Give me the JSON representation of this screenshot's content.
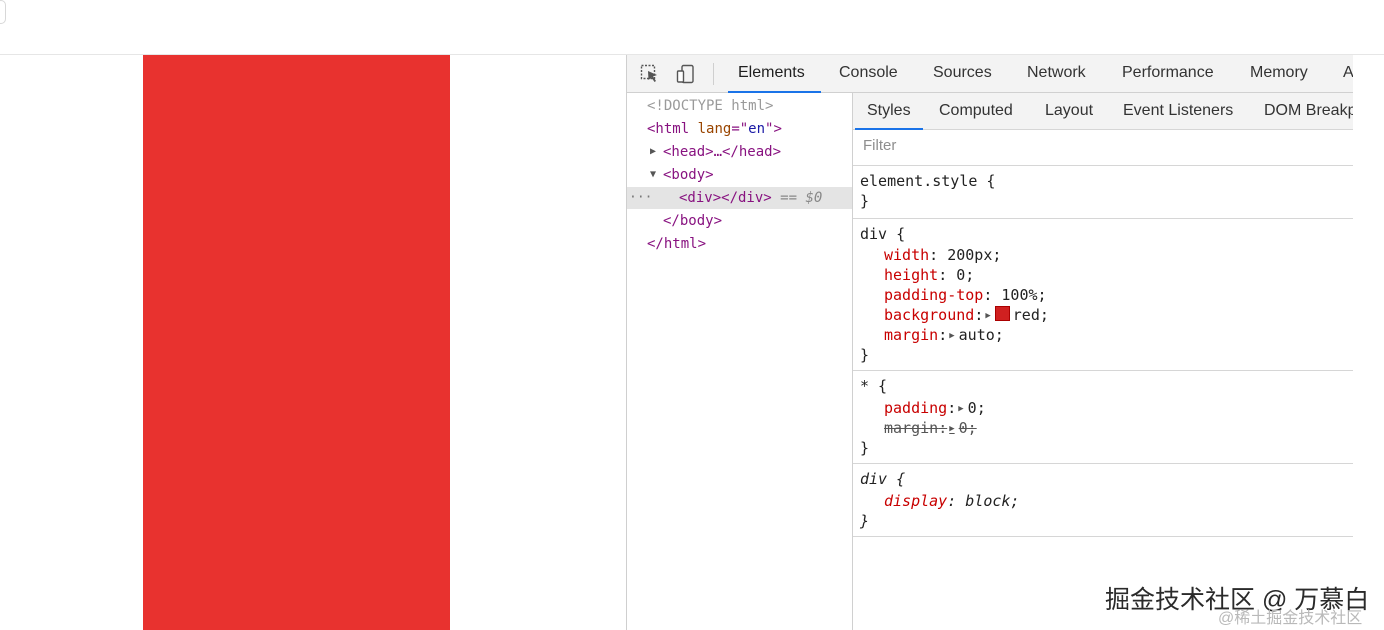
{
  "devtools": {
    "tabs": [
      {
        "label": "Elements"
      },
      {
        "label": "Console"
      },
      {
        "label": "Sources"
      },
      {
        "label": "Network"
      },
      {
        "label": "Performance"
      },
      {
        "label": "Memory"
      },
      {
        "label": "A"
      }
    ],
    "icons": [
      "inspect-element-icon",
      "device-toolbar-icon"
    ],
    "dom": {
      "doctype": "<!DOCTYPE html>",
      "html_open_tag": "<html",
      "html_attr": "lang",
      "html_attr_eq": "=\"",
      "html_attr_value": "en",
      "html_attr_close": "\">",
      "head": "<head>…</head>",
      "body_open": "<body>",
      "div": "<div></div>",
      "selected_marker": "==",
      "selected_var": "$0",
      "body_close": "</body>",
      "html_close": "</html>",
      "dots": "···"
    },
    "styles": {
      "tabs": [
        {
          "label": "Styles"
        },
        {
          "label": "Computed"
        },
        {
          "label": "Layout"
        },
        {
          "label": "Event Listeners"
        },
        {
          "label": "DOM Breakp"
        }
      ],
      "filter_placeholder": "Filter",
      "element_style": {
        "selector": "element.style {",
        "close": "}"
      },
      "rule_div": {
        "selector": "div {",
        "close": "}",
        "decls": [
          {
            "prop": "width",
            "value": "200px;"
          },
          {
            "prop": "height",
            "value": "0;"
          },
          {
            "prop": "padding-top",
            "value": "100%;"
          },
          {
            "prop": "background",
            "value": "red;"
          },
          {
            "prop": "margin",
            "value": "auto;"
          }
        ]
      },
      "rule_star": {
        "selector": "* {",
        "close": "}",
        "decls": [
          {
            "prop": "padding",
            "value": "0;"
          },
          {
            "prop": "margin",
            "value": "0;"
          }
        ]
      },
      "rule_ua": {
        "selector": "div {",
        "close": "}",
        "decls": [
          {
            "prop": "display",
            "value": "block;"
          }
        ]
      }
    }
  },
  "colors": {
    "preview_box": "#e8322f",
    "accent": "#1a73e8",
    "swatch_red": "#d02020"
  },
  "watermark": {
    "main": "掘金技术社区 @ 万慕白",
    "sub": "@稀土掘金技术社区"
  }
}
